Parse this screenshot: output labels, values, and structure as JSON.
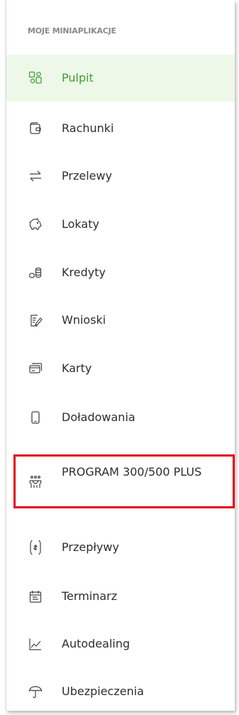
{
  "sidebar": {
    "section_title": "MOJE MINIAPLIKACJE",
    "items": [
      {
        "label": "Pulpit",
        "icon": "dashboard-icon",
        "active": true
      },
      {
        "label": "Rachunki",
        "icon": "wallet-icon"
      },
      {
        "label": "Przelewy",
        "icon": "transfer-arrows-icon"
      },
      {
        "label": "Lokaty",
        "icon": "piggy-bank-icon"
      },
      {
        "label": "Kredyty",
        "icon": "coins-icon"
      },
      {
        "label": "Wnioski",
        "icon": "document-pen-icon"
      },
      {
        "label": "Karty",
        "icon": "cards-icon"
      },
      {
        "label": "Doładowania",
        "icon": "phone-icon"
      },
      {
        "label": "PROGRAM 300/500 PLUS",
        "icon": "family-icon"
      },
      {
        "label": "Przepływy",
        "icon": "cashflow-icon"
      },
      {
        "label": "Terminarz",
        "icon": "calendar-icon"
      },
      {
        "label": "Autodealing",
        "icon": "chart-line-icon"
      },
      {
        "label": "Ubezpieczenia",
        "icon": "umbrella-icon"
      }
    ]
  },
  "colors": {
    "active_text": "#3ea033",
    "active_background": "#eef8e9",
    "text": "#2d2d2d",
    "section_title": "#8a8a8a",
    "highlight_border": "#e3001b"
  }
}
